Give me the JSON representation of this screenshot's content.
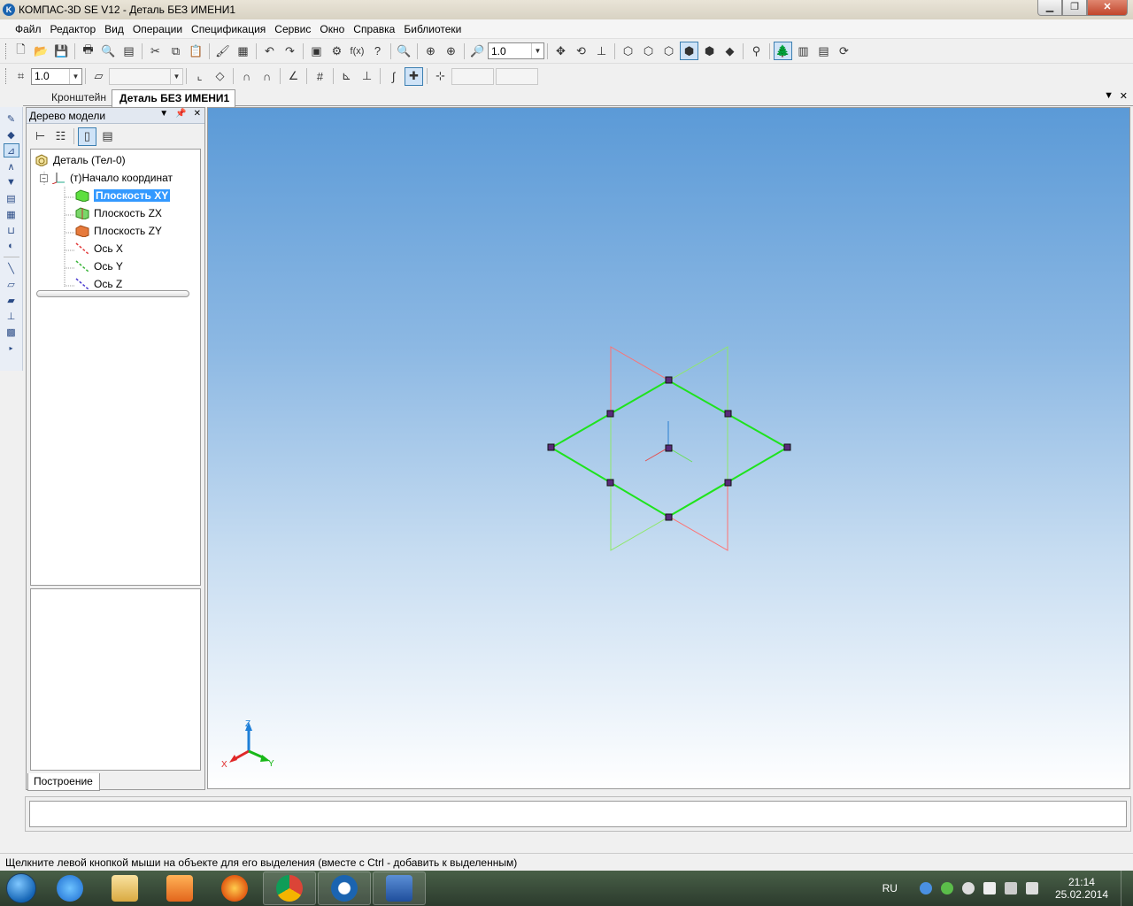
{
  "window": {
    "title": "КОМПАС-3D SE V12 - Деталь БЕЗ ИМЕНИ1",
    "app_icon": "K",
    "controls": [
      "minimize",
      "maximize",
      "close"
    ]
  },
  "menu": [
    "Файл",
    "Редактор",
    "Вид",
    "Операции",
    "Спецификация",
    "Сервис",
    "Окно",
    "Справка",
    "Библиотеки"
  ],
  "toolbar1": {
    "zoom_value": "1.0"
  },
  "toolbar2": {
    "step_value": "1.0"
  },
  "doc_tabs": [
    {
      "label": "Кронштейн",
      "active": false
    },
    {
      "label": "Деталь БЕЗ ИМЕНИ1",
      "active": true
    }
  ],
  "tree_panel": {
    "title": "Дерево модели",
    "nodes": [
      {
        "label": "Деталь (Тел-0)",
        "icon": "part-icon"
      },
      {
        "label": "(т)Начало координат",
        "icon": "origin-icon"
      },
      {
        "label": "Плоскость XY",
        "icon": "plane-xy-icon",
        "selected": true
      },
      {
        "label": "Плоскость ZX",
        "icon": "plane-zx-icon"
      },
      {
        "label": "Плоскость ZY",
        "icon": "plane-zy-icon"
      },
      {
        "label": "Ось X",
        "icon": "axis-x-icon"
      },
      {
        "label": "Ось Y",
        "icon": "axis-y-icon"
      },
      {
        "label": "Ось Z",
        "icon": "axis-z-icon"
      }
    ],
    "bottom_tab": "Построение"
  },
  "viewport": {
    "triad_labels": {
      "x": "X",
      "y": "Y",
      "z": "Z"
    },
    "colors": {
      "selected_plane": "#22dd22",
      "plane_zx": "#ff6b6b",
      "plane_zy": "#88ee66",
      "handle": "#5a2a7a"
    }
  },
  "status_text": "Щелкните левой кнопкой мыши на объекте для его выделения (вместе с Ctrl - добавить к выделенным)",
  "taskbar": {
    "apps": [
      "internet-explorer",
      "file-explorer",
      "media-player",
      "firefox",
      "chrome",
      "kompas-3d",
      "word"
    ],
    "language": "RU",
    "time": "21:14",
    "date": "25.02.2014"
  }
}
